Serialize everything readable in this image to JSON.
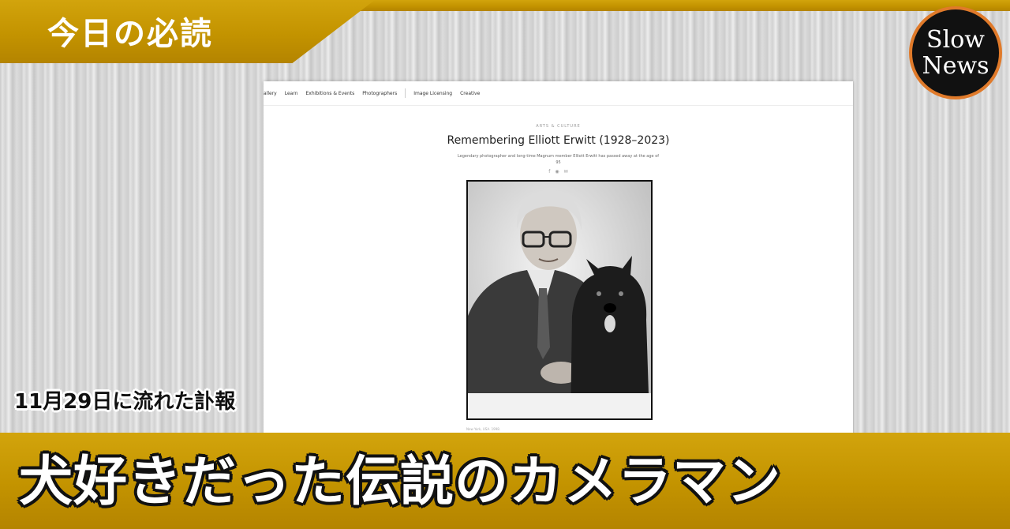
{
  "banner": {
    "tag": "今日の必読"
  },
  "logo": {
    "line1": "Slow",
    "line2": "News"
  },
  "site": {
    "nav": [
      "allery",
      "Learn",
      "Exhibitions & Events",
      "Photographers",
      "Image Licensing",
      "Creative"
    ]
  },
  "article": {
    "kicker": "ARTS & CULTURE",
    "title": "Remembering Elliott Erwitt (1928–2023)",
    "subtitle": "Legendary photographer and long-time Magnum member Elliott Erwitt has passed away at the age of 95",
    "share_icons": [
      "facebook-icon",
      "twitter-icon",
      "email-icon"
    ],
    "caption": "New York, USA. 1998."
  },
  "overlay": {
    "date_label": "11月29日に流れた訃報",
    "headline": "犬好きだった伝説のカメラマン"
  },
  "colors": {
    "gold": "#c39300",
    "logo_ring": "#e07a2a"
  }
}
